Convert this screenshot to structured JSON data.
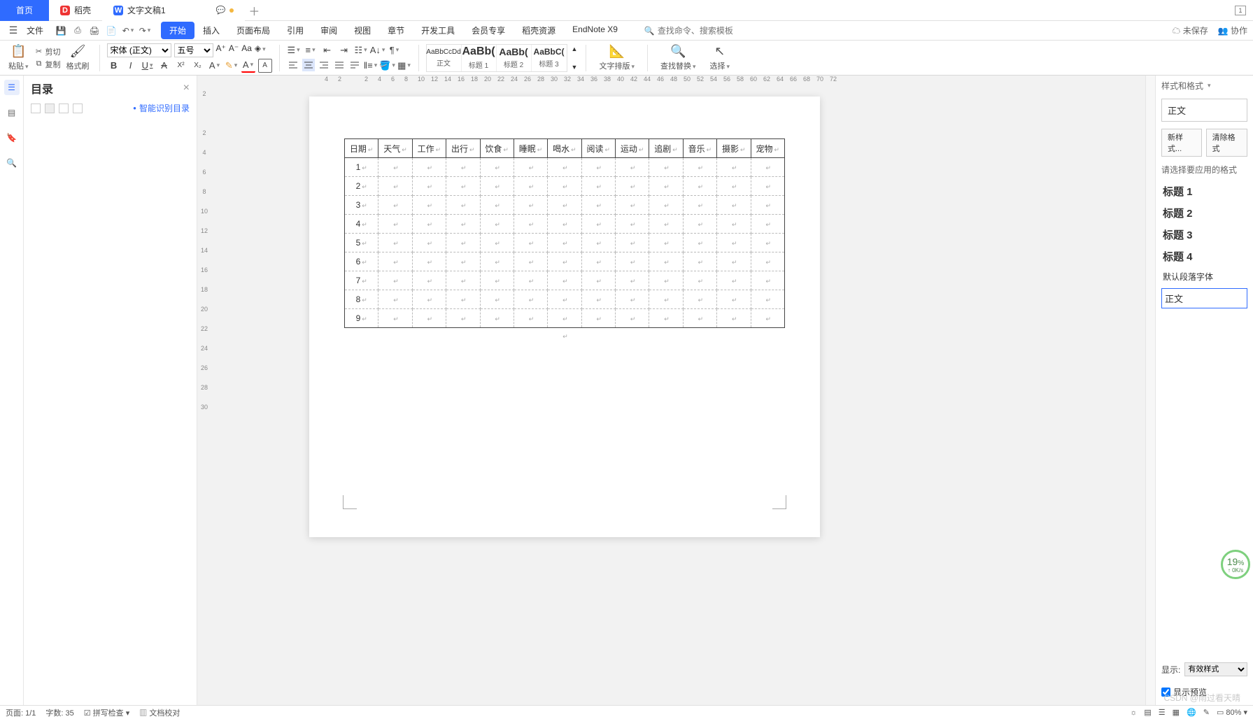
{
  "tabs": {
    "home": "首页",
    "second": "稻壳",
    "doc": "文字文稿1"
  },
  "menurow": {
    "file": "文件",
    "items": [
      "开始",
      "插入",
      "页面布局",
      "引用",
      "审阅",
      "视图",
      "章节",
      "开发工具",
      "会员专享",
      "稻壳资源",
      "EndNote X9"
    ],
    "search_placeholder": "查找命令、搜索模板",
    "unsaved": "未保存",
    "collab": "协作"
  },
  "ribbon": {
    "paste": "粘贴",
    "cut": "剪切",
    "copy": "复制",
    "formatpainter": "格式刷",
    "font_name": "宋体 (正文)",
    "font_size": "五号",
    "style_previews": [
      {
        "preview": "AaBbCcDd",
        "name": "正文"
      },
      {
        "preview": "AaBb(",
        "name": "标题 1"
      },
      {
        "preview": "AaBb(",
        "name": "标题 2"
      },
      {
        "preview": "AaBbC(",
        "name": "标题 3"
      }
    ],
    "wordlayout": "文字排版",
    "findreplace": "查找替换",
    "select": "选择"
  },
  "outline": {
    "title": "目录",
    "smart": "智能识别目录"
  },
  "ruler_h": [
    "4",
    "2",
    "",
    "2",
    "4",
    "6",
    "8",
    "10",
    "12",
    "14",
    "16",
    "18",
    "20",
    "22",
    "24",
    "26",
    "28",
    "30",
    "32",
    "34",
    "36",
    "38",
    "40",
    "42",
    "44",
    "46",
    "48",
    "50",
    "52",
    "54",
    "56",
    "58",
    "60",
    "62",
    "64",
    "66",
    "68",
    "70",
    "72"
  ],
  "ruler_v": [
    "2",
    "",
    "2",
    "4",
    "6",
    "8",
    "10",
    "12",
    "14",
    "16",
    "18",
    "20",
    "22",
    "24",
    "26",
    "28",
    "30"
  ],
  "table": {
    "headers": [
      "日期",
      "天气",
      "工作",
      "出行",
      "饮食",
      "睡眠",
      "喝水",
      "阅读",
      "运动",
      "追剧",
      "音乐",
      "摄影",
      "宠物"
    ],
    "rows": [
      "1",
      "2",
      "3",
      "4",
      "5",
      "6",
      "7",
      "8",
      "9"
    ]
  },
  "styles": {
    "panel_title": "样式和格式",
    "current": "正文",
    "new": "新样式...",
    "clear": "清除格式",
    "prompt": "请选择要应用的格式",
    "list": [
      "标题 1",
      "标题 2",
      "标题 3",
      "标题 4"
    ],
    "default_para": "默认段落字体",
    "body": "正文",
    "display": "显示:",
    "display_opt": "有效样式",
    "show_preview": "显示预览"
  },
  "status": {
    "page": "页面: 1/1",
    "words": "字数: 35",
    "spell": "拼写检查",
    "doccheck": "文档校对",
    "zoom": "80%"
  },
  "watermark": "CSDN @雨过看天晴",
  "speed": {
    "val": "19",
    "unit": "%",
    "sub": "0K/s"
  }
}
